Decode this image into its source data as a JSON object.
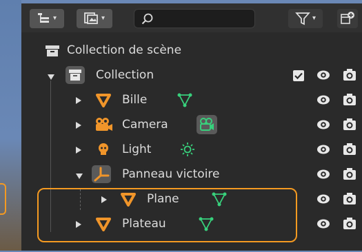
{
  "outliner": {
    "scene_collection_label": "Collection de scène",
    "rows": [
      {
        "label": "Collection"
      },
      {
        "label": "Bille"
      },
      {
        "label": "Camera"
      },
      {
        "label": "Light"
      },
      {
        "label": "Panneau victoire"
      },
      {
        "label": "Plane"
      },
      {
        "label": "Plateau"
      }
    ]
  },
  "icons": {
    "display_mode": "outliner-display-mode-icon",
    "filter": "filter-funnel-icon",
    "new_collection": "new-collection-icon",
    "visibility": "eye-icon",
    "render": "camera-render-icon"
  },
  "colors": {
    "accent_orange": "#f59a21",
    "mesh_orange": "#f0952a",
    "data_green": "#38d07c",
    "highlight": "#f59a21"
  }
}
